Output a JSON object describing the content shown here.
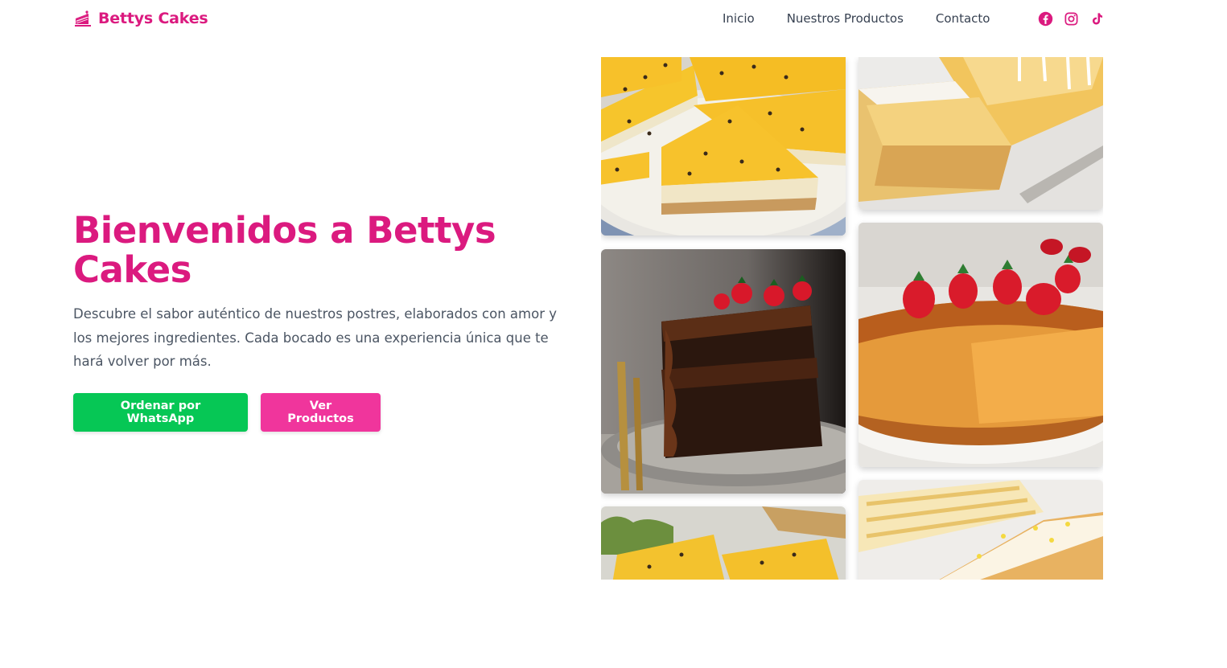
{
  "brand": {
    "name": "Bettys Cakes",
    "icon": "cake-slice-icon",
    "color": "#db1a7f"
  },
  "nav": {
    "links": [
      "Inicio",
      "Nuestros Productos",
      "Contacto"
    ]
  },
  "socials": [
    "facebook-icon",
    "instagram-icon",
    "tiktok-icon"
  ],
  "hero": {
    "title": "Bienvenidos a Bettys Cakes",
    "description": "Descubre el sabor auténtico de nuestros postres, elaborados con amor y los mejores ingredientes. Cada bocado es una experiencia única que te hará volver por más.",
    "buttons": {
      "whatsapp": "Ordenar por WhatsApp",
      "products": "Ver Productos"
    }
  },
  "colors": {
    "whatsapp": "#06c755",
    "products": "#f0359c",
    "accent": "#db1a7f"
  },
  "gallery": [
    "passion-fruit-pie-photo",
    "lemon-pound-cake-photo",
    "chocolate-cake-photo",
    "flan-with-strawberries-photo",
    "passion-fruit-pie-photo",
    "glazed-lemon-cake-photo"
  ]
}
